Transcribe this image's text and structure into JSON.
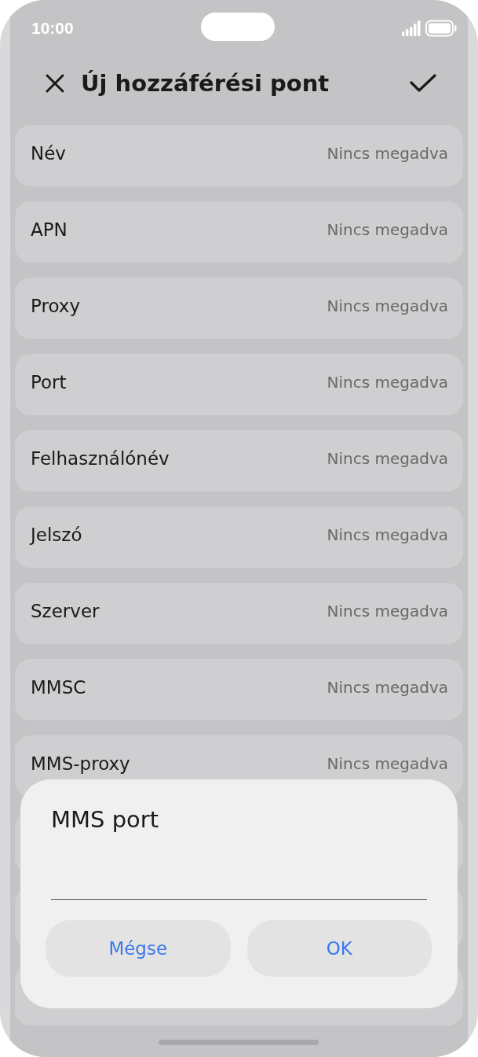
{
  "status_bar": {
    "time": "10:00"
  },
  "header": {
    "title": "Új hozzáférési pont"
  },
  "rows": [
    {
      "kind": "field",
      "label": "Név",
      "value": "Nincs megadva"
    },
    {
      "kind": "field",
      "label": "APN",
      "value": "Nincs megadva"
    },
    {
      "kind": "field",
      "label": "Proxy",
      "value": "Nincs megadva"
    },
    {
      "kind": "field",
      "label": "Port",
      "value": "Nincs megadva"
    },
    {
      "kind": "field",
      "label": "Felhasználónév",
      "value": "Nincs megadva"
    },
    {
      "kind": "field",
      "label": "Jelszó",
      "value": "Nincs megadva"
    },
    {
      "kind": "field",
      "label": "Szerver",
      "value": "Nincs megadva"
    },
    {
      "kind": "field",
      "label": "MMSC",
      "value": "Nincs megadva"
    },
    {
      "kind": "field",
      "label": "MMS-proxy",
      "value": "Nincs megadva"
    },
    {
      "kind": "covered"
    },
    {
      "kind": "covered"
    },
    {
      "kind": "covered"
    }
  ],
  "dialog": {
    "title": "MMS port",
    "buttons": [
      "Mégse",
      "OK"
    ]
  }
}
